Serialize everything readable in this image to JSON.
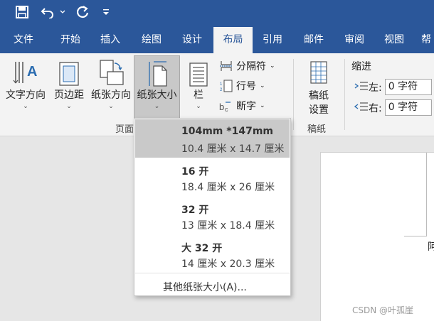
{
  "colors": {
    "title_bar": "#2b579a",
    "ribbon": "#f3f3f3",
    "selected": "#c9c9c9",
    "document_bg": "#e6e6e6"
  },
  "quick_access": {
    "save_icon": "save-icon",
    "undo_icon": "undo-icon",
    "redo_icon": "redo-icon",
    "customize_icon": "customize-qat-icon"
  },
  "tabs": [
    "文件",
    "开始",
    "插入",
    "绘图",
    "设计",
    "布局",
    "引用",
    "邮件",
    "审阅",
    "视图",
    "帮"
  ],
  "active_tab": "布局",
  "ribbon": {
    "text_direction": "文字方向",
    "margins": "页边距",
    "orientation": "纸张方向",
    "size": "纸张大小",
    "columns": "栏",
    "breaks": "分隔符",
    "line_numbers": "行号",
    "hyphenation": "断字",
    "draft_paper": [
      "稿纸",
      "设置"
    ],
    "group_page_setup": "页面",
    "group_draft": "稿纸",
    "indent_title": "缩进",
    "indent_left_label": "左:",
    "indent_left_value": "0 字符",
    "indent_right_label": "右:",
    "indent_right_value": "0 字符"
  },
  "paper_size_menu": {
    "options": [
      {
        "name": "104mm *147mm",
        "dims": "10.4 厘米 x 14.7 厘米",
        "selected": true
      },
      {
        "name": "16 开",
        "dims": "18.4 厘米 x 26 厘米",
        "selected": false
      },
      {
        "name": "32 开",
        "dims": "13 厘米 x 18.4 厘米",
        "selected": false
      },
      {
        "name": "大 32 开",
        "dims": "14 厘米 x 20.3 厘米",
        "selected": false
      }
    ],
    "more": "其他纸张大小(A)..."
  },
  "document": {
    "partial_char": "阿"
  },
  "watermark": "CSDN @叶孤崖"
}
